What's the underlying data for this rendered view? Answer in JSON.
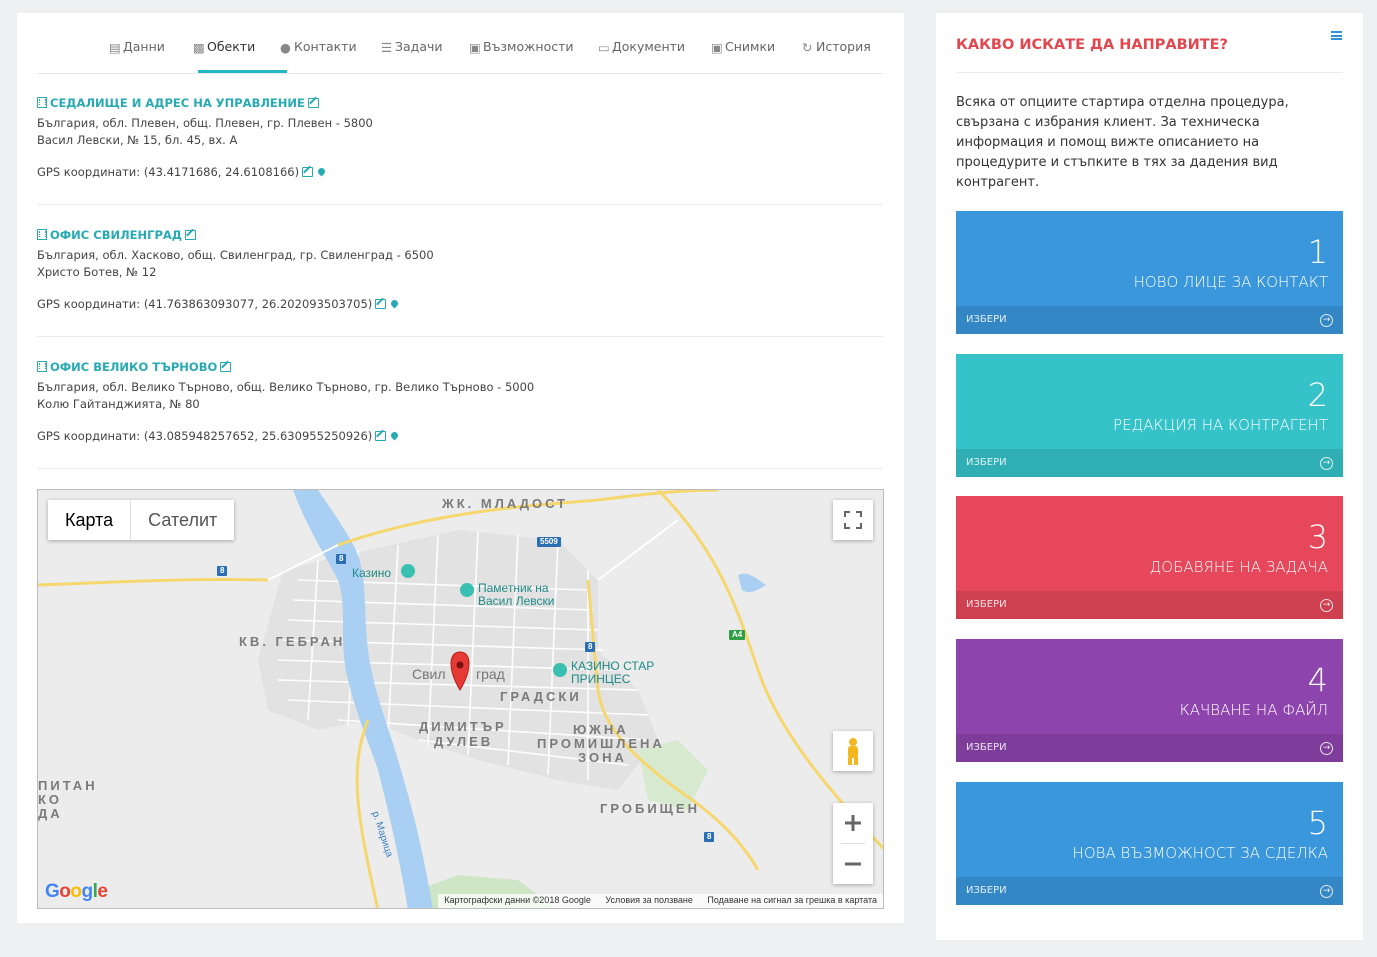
{
  "tabs": [
    {
      "label": "Данни",
      "icon": "database-icon"
    },
    {
      "label": "Обекти",
      "icon": "building-icon",
      "active": true
    },
    {
      "label": "Контакти",
      "icon": "users-icon"
    },
    {
      "label": "Задачи",
      "icon": "tasks-icon"
    },
    {
      "label": "Възможности",
      "icon": "money-icon"
    },
    {
      "label": "Документи",
      "icon": "book-icon"
    },
    {
      "label": "Снимки",
      "icon": "image-icon"
    },
    {
      "label": "История",
      "icon": "history-icon"
    }
  ],
  "objects": [
    {
      "title": "СЕДАЛИЩЕ И АДРЕС НА УПРАВЛЕНИЕ",
      "address1": "България, обл. Плевен, общ. Плевен, гр. Плевен - 5800",
      "address2": "Васил Левски, № 15, бл. 45, вх. А",
      "gps": "GPS координати: (43.4171686, 24.6108166)"
    },
    {
      "title": "ОФИС СВИЛЕНГРАД",
      "address1": "България, обл. Хасково, общ. Свиленград, гр. Свиленград - 6500",
      "address2": "Христо Ботев, № 12",
      "gps": "GPS координати: (41.763863093077, 26.202093503705)"
    },
    {
      "title": "ОФИС ВЕЛИКО ТЪРНОВО",
      "address1": "България, обл. Велико Търново, общ. Велико Търново, гр. Велико Търново - 5000",
      "address2": "Колю Гайтанджията, № 80",
      "gps": "GPS координати: (43.085948257652, 25.630955250926)"
    }
  ],
  "map": {
    "type_map": "Карта",
    "type_satellite": "Сателит",
    "labels": {
      "mladost": "ЖК. МЛАДОСТ",
      "gebran": "КВ. ГЕБРАН",
      "gradski": "ГРАДСКИ",
      "dimitar": "ДИМИТЪР",
      "dulev": "ДУЛЕВ",
      "yuzhna": "ЮЖНА",
      "promishlena": "ПРОМИШЛЕНА",
      "zona": "ЗОНА",
      "grobishten": "ГРОБИЩЕН",
      "pitan": "ПИТАН",
      "ko": "КО",
      "da": "ДА",
      "kazino": "Казино",
      "pametnik1": "Паметник на",
      "pametnik2": "Васил Левски",
      "kazino_star1": "КАЗИНО СТАР",
      "kazino_star2": "ПРИНЦЕС",
      "town_a": "Свил",
      "town_b": "град",
      "river": "р. Марица"
    },
    "shields": {
      "s5509": "5509",
      "s8": "8",
      "sA4": "A4"
    },
    "google": "Google",
    "footer_data": "Картографски данни ©2018 Google",
    "footer_terms": "Условия за ползване",
    "footer_report": "Подаване на сигнал за грешка в картата"
  },
  "panel": {
    "title": "КАКВО ИСКАТЕ ДА НАПРАВИТЕ?",
    "description": "Всяка от опциите стартира отделна процедура, свързана с избрания клиент. За техническа информация и помощ вижте описанието на процедурите и стъпките в тях за дадения вид контрагент.",
    "select_label": "ИЗБЕРИ",
    "actions": [
      {
        "num": "1",
        "label": "НОВО ЛИЦЕ ЗА КОНТАКТ",
        "color": "#3a97dc"
      },
      {
        "num": "2",
        "label": "РЕДАКЦИЯ НА КОНТРАГЕНТ",
        "color": "#35c2c8"
      },
      {
        "num": "3",
        "label": "ДОБАВЯНЕ НА ЗАДАЧА",
        "color": "#e6475a"
      },
      {
        "num": "4",
        "label": "КАЧВАНЕ НА ФАЙЛ",
        "color": "#8d45ad"
      },
      {
        "num": "5",
        "label": "НОВА ВЪЗМОЖНОСТ ЗА СДЕЛКА",
        "color": "#3a97dc"
      }
    ]
  },
  "colors": {
    "accent": "#27aab3",
    "title_red": "#e2474f"
  }
}
